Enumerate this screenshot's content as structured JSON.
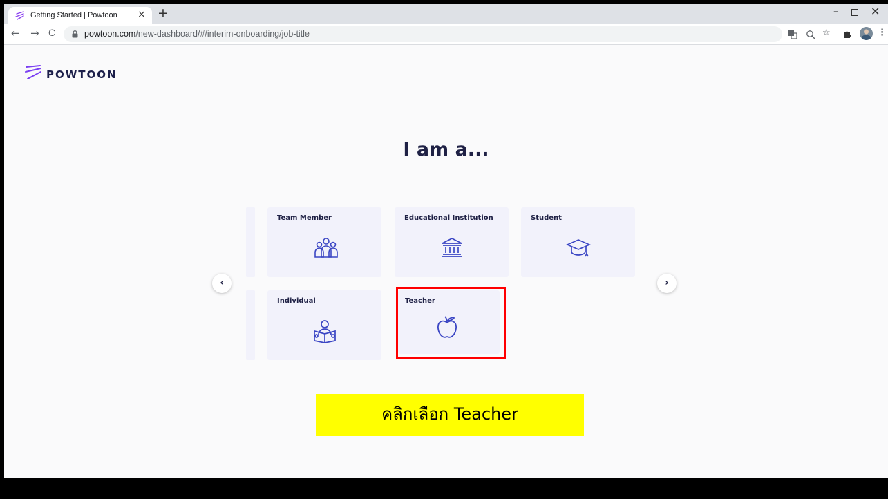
{
  "browser": {
    "tab_title": "Getting Started | Powtoon",
    "tab_close": "×",
    "new_tab": "+",
    "url_host": "powtoon.com",
    "url_path": "/new-dashboard/#/interim-onboarding/job-title",
    "window_controls": {
      "minimize": "–",
      "maximize": "",
      "close": "✕"
    },
    "nav": {
      "back": "←",
      "forward": "→",
      "reload": "C"
    }
  },
  "logo": {
    "text": "POWTOON"
  },
  "heading": "I am a...",
  "cards": [
    {
      "label": "Team Member",
      "icon": "team-icon"
    },
    {
      "label": "Educational Institution",
      "icon": "institution-icon"
    },
    {
      "label": "Student",
      "icon": "graduation-cap-icon"
    },
    {
      "label": "Individual",
      "icon": "reading-person-icon"
    },
    {
      "label": "Teacher",
      "icon": "apple-icon",
      "selected": true
    }
  ],
  "carousel": {
    "prev": "‹",
    "next": "›"
  },
  "caption": "คลิกเลือก Teacher",
  "colors": {
    "accent_highlight": "#ff0000",
    "caption_bg": "#ffff00",
    "icon_blue": "#3b46c4",
    "card_bg": "#f2f2fb",
    "heading": "#1f2145"
  }
}
